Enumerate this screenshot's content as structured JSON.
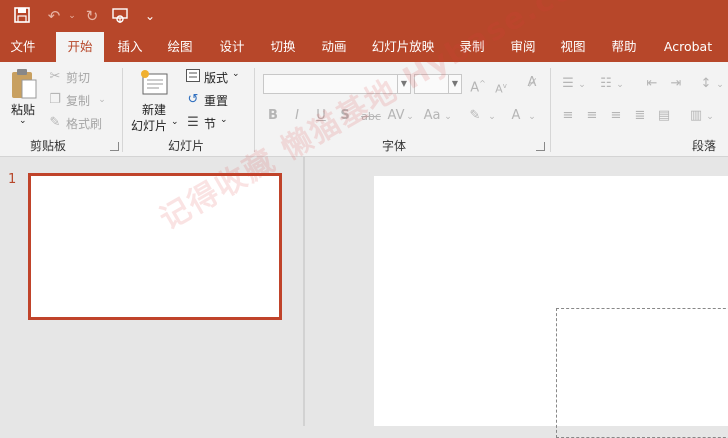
{
  "titlebar": {
    "icons": [
      "save-icon",
      "undo-icon",
      "redo-icon",
      "start-from-beginning-icon",
      "customize-qat-icon"
    ]
  },
  "tabs": [
    "文件",
    "开始",
    "插入",
    "绘图",
    "设计",
    "切换",
    "动画",
    "幻灯片放映",
    "录制",
    "审阅",
    "视图",
    "帮助",
    "Acrobat"
  ],
  "active_tab": "开始",
  "clipboard": {
    "paste_label": "粘贴",
    "cut_label": "剪切",
    "copy_label": "复制",
    "format_painter_label": "格式刷",
    "group_label": "剪贴板"
  },
  "slides_group": {
    "new_slide_label_line1": "新建",
    "new_slide_label_line2": "幻灯片",
    "layout_label": "版式",
    "reset_label": "重置",
    "section_label": "节",
    "group_label": "幻灯片"
  },
  "font_group": {
    "font_name_value": "",
    "font_size_value": "",
    "group_label": "字体",
    "format_buttons": [
      "B",
      "I",
      "U",
      "S",
      "abc",
      "AV",
      "Aa",
      "A"
    ]
  },
  "paragraph_group": {
    "group_label": "段落"
  },
  "thumbnails": {
    "slide_number": "1"
  },
  "watermark": {
    "text": "记得收藏 懒猫基地 Hybase.com"
  },
  "colors": {
    "accent": "#b7472a",
    "ribbon": "#f3f3f3",
    "workspace": "#e6e6e6"
  }
}
